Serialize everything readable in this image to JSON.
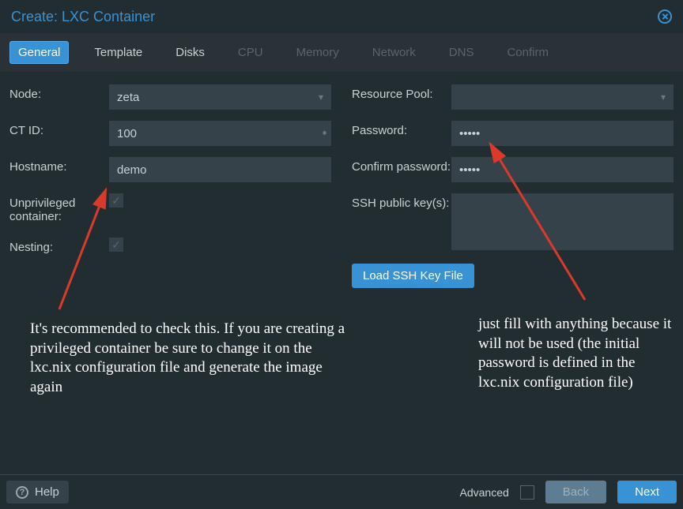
{
  "title": "Create: LXC Container",
  "tabs": [
    {
      "label": "General",
      "active": true,
      "disabled": false
    },
    {
      "label": "Template",
      "active": false,
      "disabled": false
    },
    {
      "label": "Disks",
      "active": false,
      "disabled": false
    },
    {
      "label": "CPU",
      "active": false,
      "disabled": true
    },
    {
      "label": "Memory",
      "active": false,
      "disabled": true
    },
    {
      "label": "Network",
      "active": false,
      "disabled": true
    },
    {
      "label": "DNS",
      "active": false,
      "disabled": true
    },
    {
      "label": "Confirm",
      "active": false,
      "disabled": true
    }
  ],
  "left": {
    "node_label": "Node:",
    "node_value": "zeta",
    "ctid_label": "CT ID:",
    "ctid_value": "100",
    "hostname_label": "Hostname:",
    "hostname_value": "demo",
    "unpriv_label": "Unprivileged container:",
    "unpriv_checked": true,
    "nesting_label": "Nesting:",
    "nesting_checked": true
  },
  "right": {
    "pool_label": "Resource Pool:",
    "pool_value": "",
    "password_label": "Password:",
    "password_value": "•••••",
    "confirm_label": "Confirm password:",
    "confirm_value": "•••••",
    "ssh_label": "SSH public key(s):",
    "ssh_value": "",
    "load_key_btn": "Load SSH Key File"
  },
  "footer": {
    "help": "Help",
    "advanced": "Advanced",
    "back": "Back",
    "next": "Next"
  },
  "annotations": {
    "left_text": "It's recommended to check this. If you are creating a privileged container be sure to change it on the lxc.nix configuration file and generate the image again",
    "right_text": "just fill with anything because it will not be used (the initial password is defined in the lxc.nix configuration file)"
  },
  "colors": {
    "accent": "#3892d4",
    "arrow": "#d93a2b"
  }
}
